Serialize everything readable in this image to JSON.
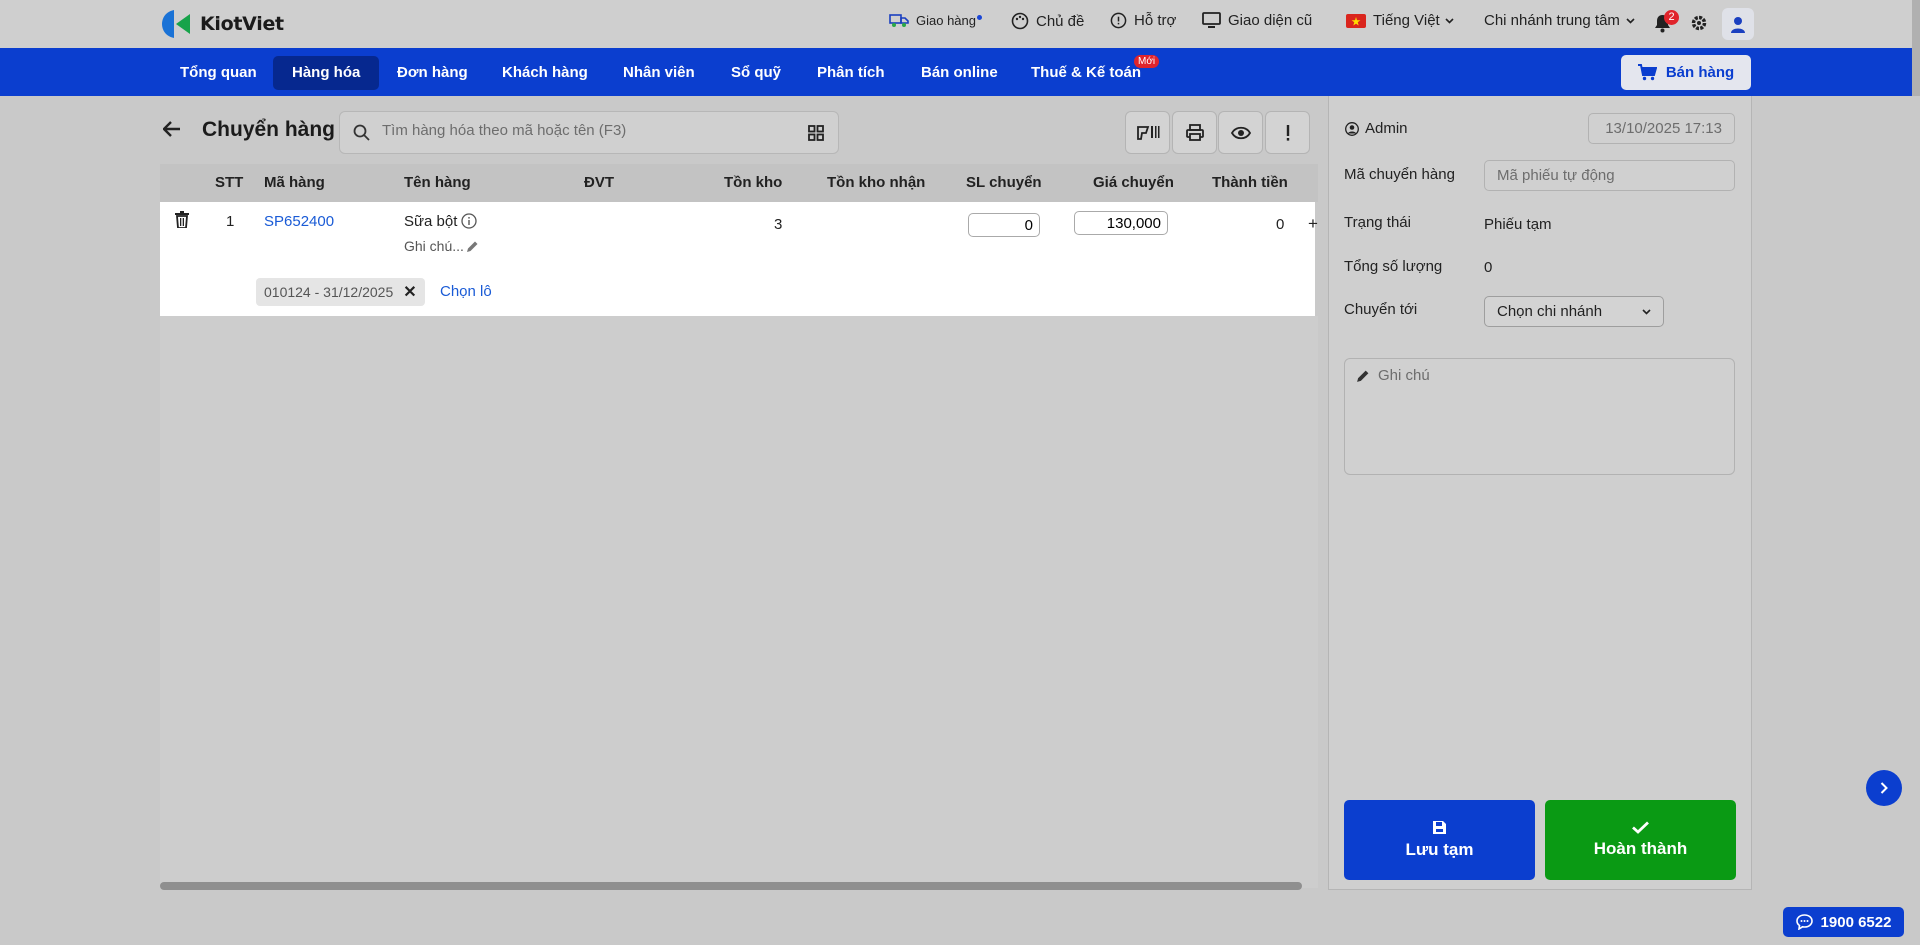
{
  "header": {
    "logo_text": "KiotViet",
    "delivery": "Giao hàng",
    "theme": "Chủ đề",
    "support": "Hỗ trợ",
    "old_ui": "Giao diện cũ",
    "language": "Tiếng Việt",
    "branch": "Chi nhánh trung tâm",
    "notification_count": "2"
  },
  "nav": {
    "items": [
      "Tổng quan",
      "Hàng hóa",
      "Đơn hàng",
      "Khách hàng",
      "Nhân viên",
      "Sổ quỹ",
      "Phân tích",
      "Bán online",
      "Thuế & Kế toán"
    ],
    "active_index": 1,
    "new_badge": "Mới",
    "sell_button": "Bán hàng"
  },
  "page": {
    "title": "Chuyển hàng",
    "search_placeholder": "Tìm hàng hóa theo mã hoặc tên (F3)"
  },
  "table": {
    "columns": [
      "STT",
      "Mã hàng",
      "Tên hàng",
      "ĐVT",
      "Tồn kho",
      "Tồn kho nhận",
      "SL chuyển",
      "Giá chuyển",
      "Thành tiền"
    ],
    "rows": [
      {
        "stt": "1",
        "code": "SP652400",
        "name": "Sữa bột",
        "note": "Ghi chú...",
        "unit": "",
        "stock": "3",
        "stock_receive": "",
        "qty": "0",
        "price": "130,000",
        "total": "0",
        "lot": "010124 - 31/12/2025",
        "choose_lot": "Chọn lô"
      }
    ]
  },
  "panel": {
    "user": "Admin",
    "datetime": "13/10/2025 17:13",
    "code_label": "Mã chuyển hàng",
    "code_placeholder": "Mã phiếu tự động",
    "status_label": "Trạng thái",
    "status_value": "Phiếu tạm",
    "total_qty_label": "Tổng số lượng",
    "total_qty_value": "0",
    "transfer_to_label": "Chuyển tới",
    "transfer_to_value": "Chọn chi nhánh",
    "notes_placeholder": "Ghi chú",
    "save_draft": "Lưu tạm",
    "complete": "Hoàn thành"
  },
  "hotline": "1900 6522",
  "colors": {
    "primary": "#0b3ecf",
    "nav_active": "#06288f",
    "success": "#0a9a14",
    "badge": "#e0242b",
    "link": "#1a5bd6"
  }
}
